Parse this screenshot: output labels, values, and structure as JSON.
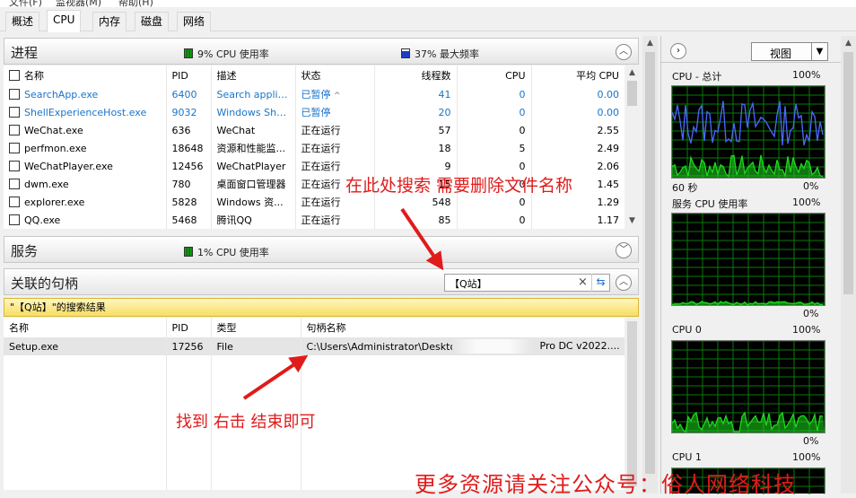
{
  "menu": [
    "文件(F)",
    "监视器(M)",
    "帮助(H)"
  ],
  "tabs": [
    "概述",
    "CPU",
    "内存",
    "磁盘",
    "网络"
  ],
  "processes": {
    "title": "进程",
    "cpu_usage": "9% CPU 使用率",
    "max_freq": "37% 最大频率",
    "columns": [
      "名称",
      "PID",
      "描述",
      "状态",
      "线程数",
      "CPU",
      "平均 CPU"
    ],
    "rows": [
      {
        "name": "SearchApp.exe",
        "pid": "6400",
        "desc": "Search applic...",
        "status": "已暂停",
        "threads": "41",
        "cpu": "0",
        "avg": "0.00",
        "suspended": true
      },
      {
        "name": "ShellExperienceHost.exe",
        "pid": "9032",
        "desc": "Windows She...",
        "status": "已暂停",
        "threads": "20",
        "cpu": "0",
        "avg": "0.00",
        "suspended": true
      },
      {
        "name": "WeChat.exe",
        "pid": "636",
        "desc": "WeChat",
        "status": "正在运行",
        "threads": "57",
        "cpu": "0",
        "avg": "2.55",
        "suspended": false
      },
      {
        "name": "perfmon.exe",
        "pid": "18648",
        "desc": "资源和性能监...",
        "status": "正在运行",
        "threads": "18",
        "cpu": "5",
        "avg": "2.49",
        "suspended": false
      },
      {
        "name": "WeChatPlayer.exe",
        "pid": "12456",
        "desc": "WeChatPlayer",
        "status": "正在运行",
        "threads": "9",
        "cpu": "0",
        "avg": "2.06",
        "suspended": false
      },
      {
        "name": "dwm.exe",
        "pid": "780",
        "desc": "桌面窗口管理器",
        "status": "正在运行",
        "threads": "15",
        "cpu": "0",
        "avg": "1.45",
        "suspended": false
      },
      {
        "name": "explorer.exe",
        "pid": "5828",
        "desc": "Windows 资...",
        "status": "正在运行",
        "threads": "548",
        "cpu": "0",
        "avg": "1.29",
        "suspended": false
      },
      {
        "name": "QQ.exe",
        "pid": "5468",
        "desc": "腾讯QQ",
        "status": "正在运行",
        "threads": "85",
        "cpu": "0",
        "avg": "1.17",
        "suspended": false
      }
    ]
  },
  "services": {
    "title": "服务",
    "cpu_usage": "1% CPU 使用率"
  },
  "handles": {
    "title": "关联的句柄",
    "search_value": "【Q站】",
    "result_text": "\"【Q站】\"的搜索结果",
    "columns": [
      "名称",
      "PID",
      "类型",
      "句柄名称"
    ],
    "rows": [
      {
        "name": "Setup.exe",
        "pid": "17256",
        "type": "File",
        "handle_left": "C:\\Users\\Administrator\\Desktop",
        "handle_right": "Pro DC v2022...."
      }
    ]
  },
  "right_panel": {
    "view_label": "视图",
    "graphs": [
      {
        "title": "CPU - 总计",
        "max": "100%",
        "footer_left": "60 秒",
        "footer_right": "0%"
      },
      {
        "title": "服务 CPU 使用率",
        "max": "100%",
        "footer_left": "",
        "footer_right": "0%"
      },
      {
        "title": "CPU 0",
        "max": "100%",
        "footer_left": "",
        "footer_right": "0%"
      },
      {
        "title": "CPU 1",
        "max": "100%",
        "footer_left": "",
        "footer_right": ""
      }
    ]
  },
  "annotations": {
    "search_hint": "在此处搜索 需要删除文件名称",
    "action_hint": "找到 右击 结束即可",
    "watermark": "更多资源请关注公众号：俗人网络科技"
  },
  "colors": {
    "suspended_text": "#1a74c9",
    "annotation_red": "#e01b1b",
    "graph_grid": "#0a7a0a",
    "graph_total": "#4a6bff",
    "graph_usage": "#1ed81e"
  }
}
